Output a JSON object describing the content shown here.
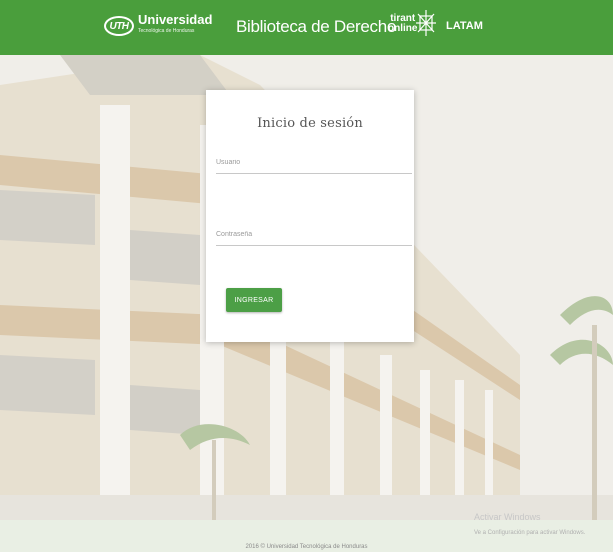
{
  "header": {
    "logo_mark": "UTH",
    "university_name": "Universidad",
    "university_sub": "Tecnológica de Honduras",
    "site_title": "Biblioteca de Derecho",
    "partner_line1": "tirant",
    "partner_line2": "online",
    "partner_region": "LATAM",
    "bg_color": "#4a9e3c"
  },
  "login": {
    "title": "Inicio de sesión",
    "username_placeholder": "Usuario",
    "username_value": "",
    "password_placeholder": "Contraseña",
    "password_value": "",
    "submit_label": "INGRESAR",
    "accent_color": "#4c9f46"
  },
  "footer": {
    "copyright": "2016 © Universidad Tecnológica de Honduras"
  },
  "windows_watermark": {
    "title": "Activar Windows",
    "subtitle": "Ve a Configuración para activar Windows."
  }
}
